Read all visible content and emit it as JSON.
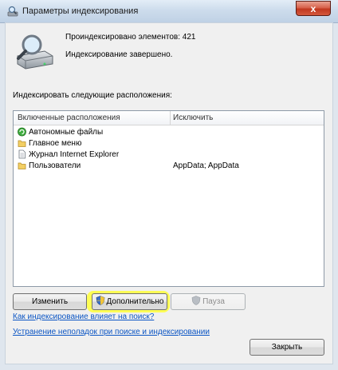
{
  "window": {
    "title": "Параметры индексирования",
    "close_glyph": "x",
    "icon": "indexing-options-icon"
  },
  "summary": {
    "indexed_count": "Проиндексировано элементов: 421",
    "status": "Индексирование завершено."
  },
  "locations": {
    "label": "Индексировать следующие расположения:",
    "col_included": "Включенные расположения",
    "col_exclude": "Исключить",
    "rows": [
      {
        "name": "Автономные файлы",
        "exclude": "",
        "icon": "offline-files-icon"
      },
      {
        "name": "Главное меню",
        "exclude": "",
        "icon": "folder-icon"
      },
      {
        "name": "Журнал Internet Explorer",
        "exclude": "",
        "icon": "document-icon"
      },
      {
        "name": "Пользователи",
        "exclude": "AppData; AppData",
        "icon": "folder-icon"
      }
    ]
  },
  "buttons": {
    "modify": "Изменить",
    "advanced": "Дополнительно",
    "pause": "Пауза",
    "close": "Закрыть"
  },
  "links": {
    "affect_search": "Как индексирование влияет на поиск?",
    "troubleshoot": "Устранение неполадок при поиске и индексировании"
  },
  "colors": {
    "link": "#0b55c4",
    "highlight": "#ffff3a",
    "close_button": "#c1381f"
  }
}
